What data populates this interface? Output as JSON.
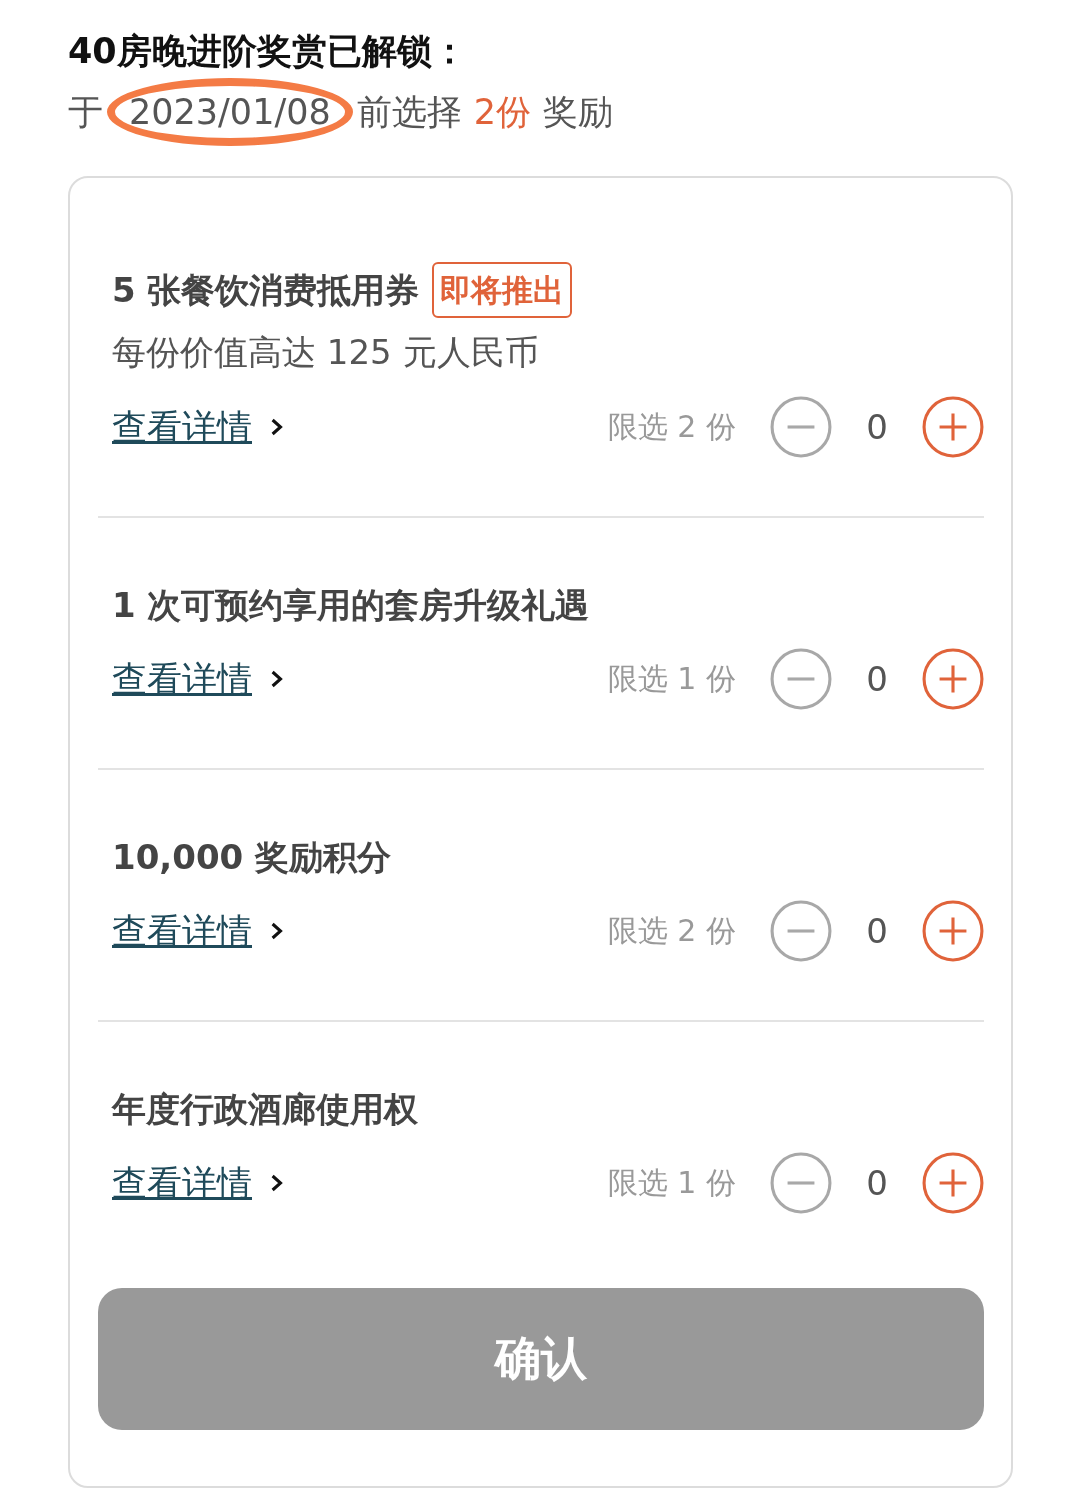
{
  "header": {
    "title": "40房晚进阶奖赏已解锁：",
    "subtitle_prefix": "于",
    "subtitle_date": "2023/01/08",
    "subtitle_middle": "前选择",
    "subtitle_highlight": "2份",
    "subtitle_suffix": "奖励"
  },
  "rewards": [
    {
      "title": "5 张餐饮消费抵用券",
      "badge": "即将推出",
      "description": "每份价值高达 125 元人民币",
      "link": "查看详情",
      "limit": "限选 2 份",
      "count": "0",
      "minus_disabled": true
    },
    {
      "title": "1 次可预约享用的套房升级礼遇",
      "link": "查看详情",
      "limit": "限选 1 份",
      "count": "0",
      "minus_disabled": true
    },
    {
      "title": "10,000 奖励积分",
      "link": "查看详情",
      "limit": "限选 2 份",
      "count": "0",
      "minus_disabled": true
    },
    {
      "title": "年度行政酒廊使用权",
      "link": "查看详情",
      "limit": "限选 1 份",
      "count": "0",
      "minus_disabled": true
    }
  ],
  "confirm": {
    "label": "确认",
    "disabled": true
  }
}
